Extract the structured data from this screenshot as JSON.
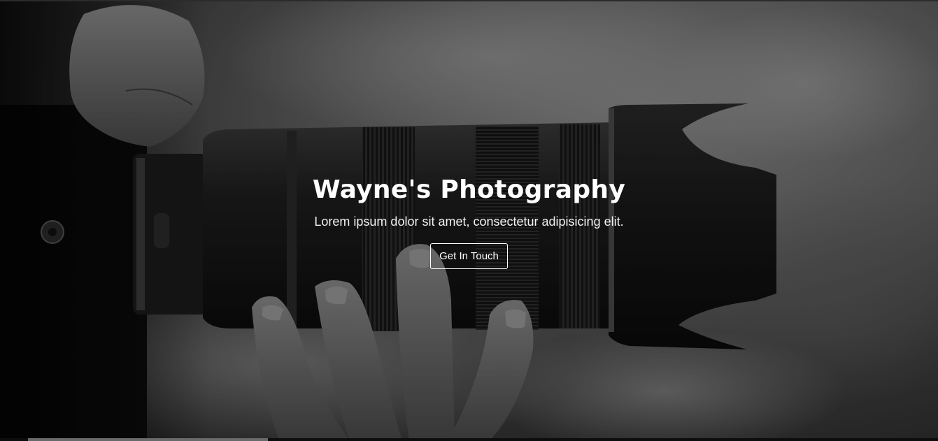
{
  "hero": {
    "title": "Wayne's Photography",
    "subtitle": "Lorem ipsum dolor sit amet, consectetur adipisicing elit.",
    "cta_label": "Get In Touch"
  },
  "colors": {
    "text": "#ffffff",
    "button_border": "#ffffff",
    "background_dark": "#1a1a1a"
  }
}
